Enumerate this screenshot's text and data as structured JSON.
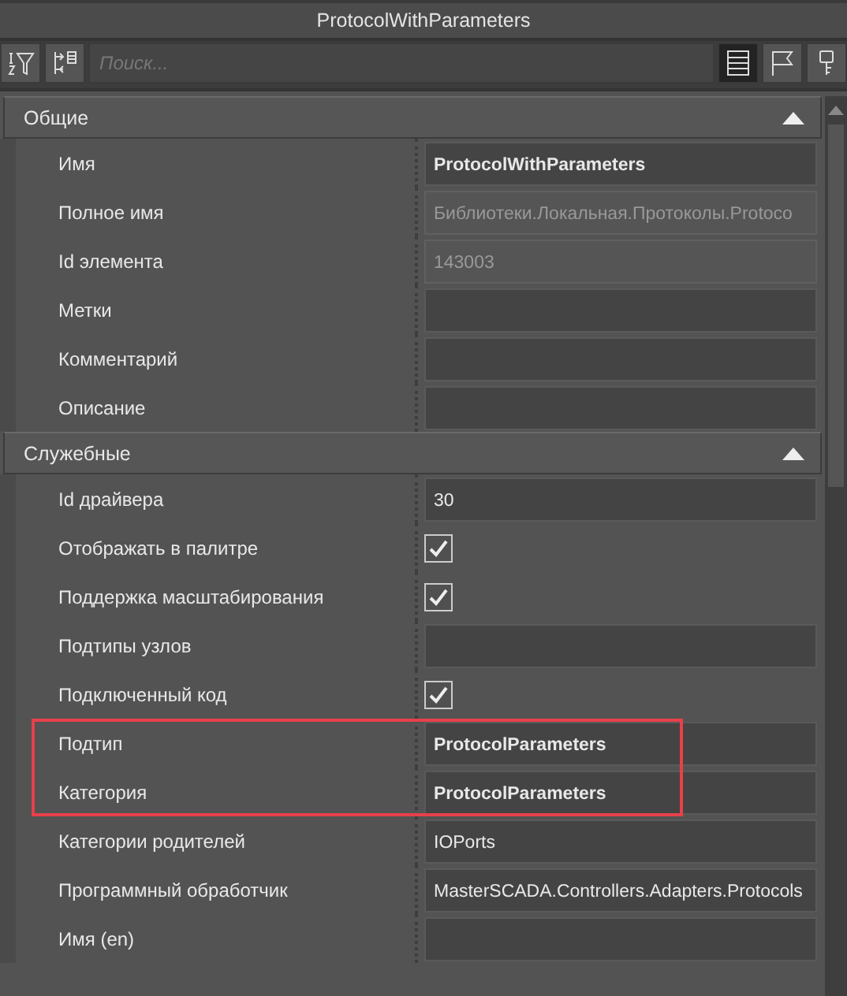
{
  "window": {
    "title": "ProtocolWithParameters"
  },
  "toolbar": {
    "left_buttons": [
      {
        "kind": "sort-filter"
      },
      {
        "kind": "collapse"
      }
    ],
    "search": {
      "placeholder": "Поиск..."
    },
    "view_buttons": [
      {
        "kind": "list",
        "selected": true
      },
      {
        "kind": "flag",
        "selected": false
      },
      {
        "kind": "key",
        "selected": false
      }
    ]
  },
  "sections": [
    {
      "title": "Общие",
      "expanded": true,
      "rows": [
        {
          "label": "Имя",
          "kind": "text",
          "value": "ProtocolWithParameters",
          "bold": true,
          "readonly": false,
          "highlighted": false
        },
        {
          "label": "Полное имя",
          "kind": "text",
          "value": "Библиотеки.Локальная.Протоколы.Protoco",
          "bold": false,
          "readonly": true,
          "highlighted": false
        },
        {
          "label": "Id элемента",
          "kind": "text",
          "value": "143003",
          "bold": false,
          "readonly": true,
          "highlighted": false
        },
        {
          "label": "Метки",
          "kind": "text",
          "bold": false,
          "readonly": false,
          "highlighted": false
        },
        {
          "label": "Комментарий",
          "kind": "text",
          "bold": false,
          "readonly": false,
          "highlighted": false
        },
        {
          "label": "Описание",
          "kind": "text",
          "bold": false,
          "readonly": false,
          "highlighted": false
        }
      ]
    },
    {
      "title": "Служебные",
      "expanded": true,
      "rows": [
        {
          "label": "Id драйвера",
          "kind": "text",
          "value": "30",
          "bold": false,
          "readonly": false,
          "highlighted": false
        },
        {
          "label": "Отображать в палитре",
          "kind": "checkbox",
          "checked": true,
          "highlighted": false
        },
        {
          "label": "Поддержка масштабирования",
          "kind": "checkbox",
          "checked": true,
          "highlighted": false
        },
        {
          "label": "Подтипы узлов",
          "kind": "text",
          "bold": false,
          "readonly": false,
          "highlighted": false
        },
        {
          "label": "Подключенный код",
          "kind": "checkbox",
          "checked": true,
          "highlighted": false
        },
        {
          "label": "Подтип",
          "kind": "text",
          "value": "ProtocolParameters",
          "bold": true,
          "readonly": false,
          "highlighted": true
        },
        {
          "label": "Категория",
          "kind": "text",
          "value": "ProtocolParameters",
          "bold": true,
          "readonly": false,
          "highlighted": true
        },
        {
          "label": "Категории родителей",
          "kind": "text",
          "value": "IOPorts",
          "bold": false,
          "readonly": false,
          "highlighted": false
        },
        {
          "label": "Программный обработчик",
          "kind": "text",
          "value": "MasterSCADA.Controllers.Adapters.Protocols",
          "bold": false,
          "readonly": false,
          "highlighted": false
        },
        {
          "label": "Имя (en)",
          "kind": "text",
          "bold": false,
          "readonly": false,
          "highlighted": false
        }
      ]
    }
  ]
}
